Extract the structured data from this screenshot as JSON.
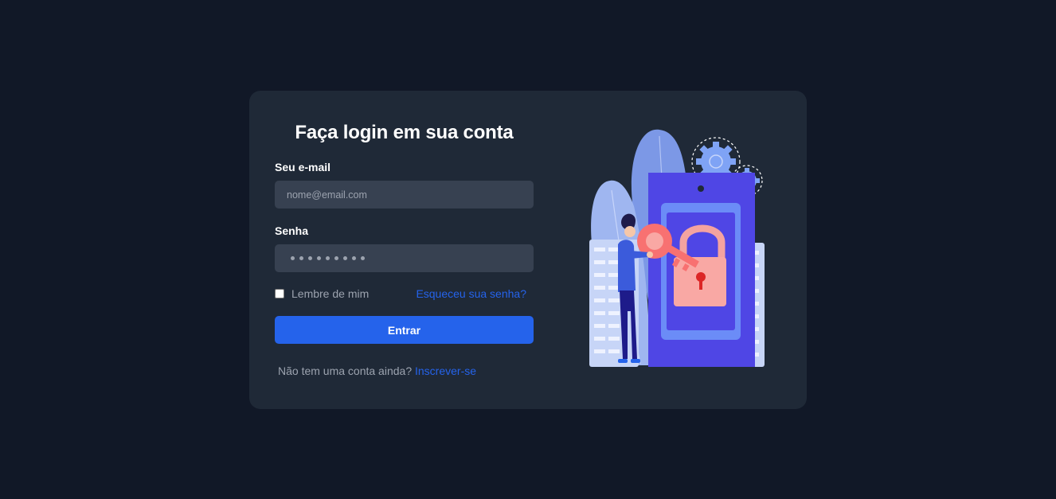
{
  "login": {
    "title": "Faça login em sua conta",
    "email_label": "Seu e-mail",
    "email_placeholder": "nome@email.com",
    "password_label": "Senha",
    "password_dots_count": 9,
    "remember_label": "Lembre de mim",
    "remember_checked": false,
    "forgot_link": "Esqueceu sua senha?",
    "submit_label": "Entrar",
    "signup_text": "Não tem uma conta ainda?",
    "signup_link": "Inscrever-se"
  },
  "illustration": {
    "icon": "security-lock-key-illustration"
  },
  "colors": {
    "page_bg": "#111827",
    "card_bg": "#1f2937",
    "input_bg": "#374151",
    "accent": "#2563eb",
    "muted_text": "#9ca3af",
    "illustration_primary": "#4f46e5",
    "illustration_key": "#f87171"
  }
}
